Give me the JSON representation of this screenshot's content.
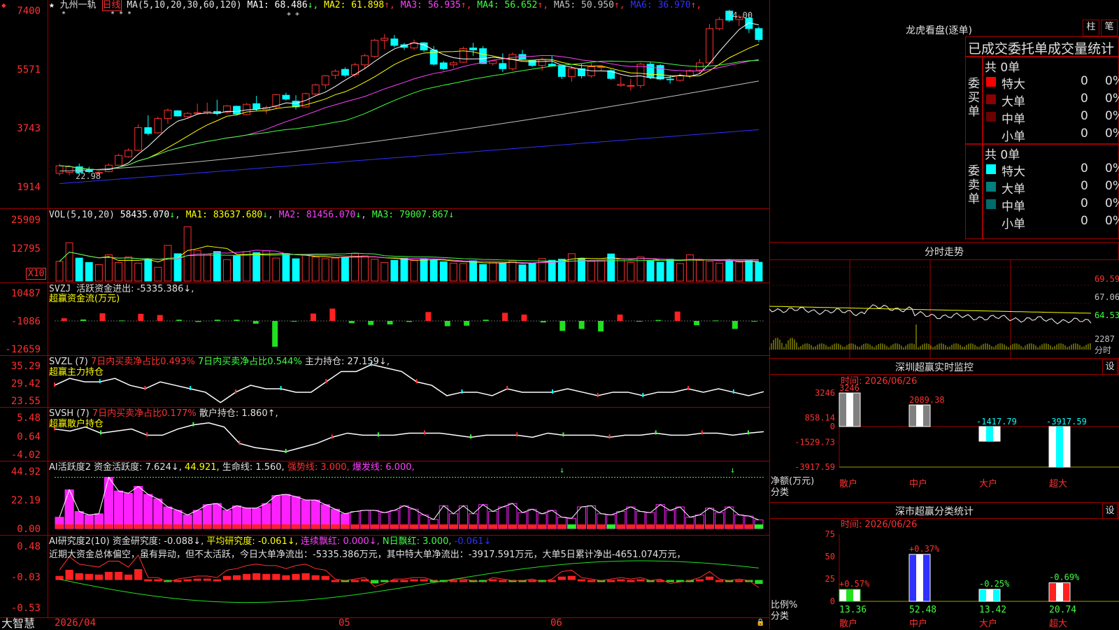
{
  "title": {
    "stock_name": "九州一轨",
    "period": "日线",
    "stars": "★",
    "ma_label": "MA(5,10,20,30,60,120)",
    "ma": [
      {
        "name": "MA1:",
        "value": "68.486",
        "arrow": "↓",
        "color": "#ffffff"
      },
      {
        "name": "MA2:",
        "value": "61.898",
        "arrow": "↑",
        "color": "#ffff00"
      },
      {
        "name": "MA3:",
        "value": "56.935",
        "arrow": "↑",
        "color": "#ff40ff"
      },
      {
        "name": "MA4:",
        "value": "56.652",
        "arrow": "↑",
        "color": "#40ff40"
      },
      {
        "name": "MA5:",
        "value": "50.950",
        "arrow": "↑",
        "color": "#c0c0c0"
      },
      {
        "name": "MA6:",
        "value": "36.970",
        "arrow": "↑",
        "color": "#3030ff"
      }
    ]
  },
  "vol_header": {
    "label": "VOL(5,10,20)",
    "value": "58435.070",
    "ma1": "MA1: 83637.680",
    "ma2": "MA2: 81456.070",
    "ma3": "MA3: 79007.867",
    "arrow": "↓",
    "unit": "X10"
  },
  "svzj_header": {
    "label": "SVZJ",
    "line": "活跃资金进出: -5335.386↓,",
    "sub": "超赢资金流(万元)"
  },
  "svzl_header": {
    "label": "SVZL (7)",
    "a": "7日内买卖净占比0.493%",
    "b": "7日内买卖净占比0.544%",
    "c": "主力持仓: 27.159↓,",
    "sub": "超赢主力持仓"
  },
  "svsh_header": {
    "label": "SVSH (7)",
    "a": "7日内买卖净占比0.177%",
    "c": "散户持仓: 1.860↑,",
    "sub": "超赢散户持仓"
  },
  "ai1_header": {
    "label": "AI活跃度2",
    "a": "资金活跃度: 7.624↓,",
    "b": "44.921,",
    "c": "生命线: 1.560,",
    "d": "强势线: 3.000,",
    "e": "爆发线: 6.000,"
  },
  "ai2_header": {
    "label": "AI研究度2(10)",
    "a": "资金研究度: -0.088↓,",
    "b": "平均研究度: -0.061↓,",
    "c": "连续飘红: 0.000↓,",
    "d": "N日飘红: 3.000,",
    "e": "-0.061↓"
  },
  "commentary": "近期大资金总体偏空，虽有异动，但不太活跃，今日大单净流出：-5335.386万元，其中特大单净流出：-3917.591万元，大单5日累计净出-4651.074万元，",
  "x_axis": {
    "app_name": "大智慧",
    "d0": "2026/04",
    "d1": "05",
    "d2": "06"
  },
  "right": {
    "dragon": {
      "title": "龙虎看盘(逐单)",
      "btn1": "柱",
      "btn2": "笔",
      "stat_title": "已成交委托单成交量统计",
      "buy_label": "委买单",
      "sell_label": "委卖单",
      "buy_total": "共 0单",
      "sell_total": "共 0单",
      "buy_rows": [
        {
          "name": "特大",
          "qty": "0",
          "pct": "0%",
          "color": "#ff0000"
        },
        {
          "name": "大单",
          "qty": "0",
          "pct": "0%",
          "color": "#8b0000"
        },
        {
          "name": "中单",
          "qty": "0",
          "pct": "0%",
          "color": "#6b0000"
        },
        {
          "name": "小单",
          "qty": "0",
          "pct": "0%",
          "color": ""
        }
      ],
      "sell_rows": [
        {
          "name": "特大",
          "qty": "0",
          "pct": "0%",
          "color": "#00ffff"
        },
        {
          "name": "大单",
          "qty": "0",
          "pct": "0%",
          "color": "#008080"
        },
        {
          "name": "中单",
          "qty": "0",
          "pct": "0%",
          "color": "#006b6b"
        },
        {
          "name": "小单",
          "qty": "0",
          "pct": "0%",
          "color": ""
        }
      ]
    },
    "minute": {
      "title": "分时走势",
      "p1": "69.59",
      "p2": "67.06",
      "p3": "64.53",
      "vol": "2287",
      "vol_unit": "分时"
    },
    "monitor": {
      "title": "深圳超赢实时监控",
      "btn": "设",
      "time": "时间: 2026/06/26",
      "ylabel": "净额(万元)",
      "xlabel": "分类"
    },
    "classify": {
      "title": "深市超赢分类统计",
      "btn": "设",
      "time": "时间: 2026/06/26",
      "ylabel": "比例%",
      "xlabel": "分类"
    }
  },
  "chart_data": [
    {
      "type": "candlestick",
      "title": "九州一轨 日线",
      "ylim": [
        19.14,
        74.0
      ],
      "y_ticks": [
        "7400",
        "5571",
        "3743",
        "1914"
      ],
      "annotations": [
        "74.00",
        "22.98"
      ],
      "ohlc": [
        [
          23.5,
          26.5,
          22.8,
          25.8
        ],
        [
          23.8,
          26,
          22.9,
          25.5
        ],
        [
          25.5,
          26.5,
          23.2,
          23.8
        ],
        [
          24.5,
          25.5,
          23.5,
          24
        ],
        [
          23.5,
          24.2,
          22.98,
          23.8
        ],
        [
          24,
          26.5,
          23.8,
          26
        ],
        [
          26,
          29.5,
          25.8,
          29
        ],
        [
          28.6,
          31.2,
          28.3,
          30.6
        ],
        [
          30.6,
          38.6,
          30.4,
          37.6
        ],
        [
          37.6,
          41.4,
          35.2,
          35.8
        ],
        [
          36,
          41,
          35.8,
          40.4
        ],
        [
          40.4,
          43.5,
          38.8,
          43
        ],
        [
          42.8,
          43,
          41,
          41.2
        ],
        [
          41,
          42.4,
          40.5,
          42
        ],
        [
          42.2,
          45,
          41.8,
          42.2
        ],
        [
          42.2,
          45.3,
          41.6,
          42.6
        ],
        [
          42.6,
          46.2,
          41.4,
          42
        ],
        [
          42.4,
          44.6,
          42,
          44.3
        ],
        [
          44.2,
          44.4,
          41.6,
          41.8
        ],
        [
          41.6,
          45.2,
          41.4,
          44.8
        ],
        [
          45,
          47.4,
          42.8,
          43.4
        ],
        [
          43.2,
          44.4,
          41.8,
          43.8
        ],
        [
          44,
          48,
          43.4,
          47.8
        ],
        [
          47.6,
          48.4,
          46,
          46.4
        ],
        [
          45.8,
          47.6,
          43.2,
          44
        ],
        [
          44,
          48.4,
          43.8,
          48.1
        ],
        [
          48,
          51.2,
          47.6,
          50.8
        ],
        [
          50.8,
          53.8,
          49.6,
          53.6
        ],
        [
          53.8,
          55.6,
          52.6,
          55
        ],
        [
          55.6,
          56.2,
          53.2,
          53.8
        ],
        [
          54,
          57.6,
          53.2,
          57
        ],
        [
          57,
          60.4,
          55.8,
          59.8
        ],
        [
          59.6,
          65,
          59.2,
          64.6
        ],
        [
          64.6,
          66.5,
          61.8,
          65.2
        ],
        [
          65,
          66.2,
          62.4,
          63
        ],
        [
          63.2,
          63.8,
          61.6,
          62.4
        ],
        [
          62.2,
          64.8,
          61.6,
          63.8
        ],
        [
          63.8,
          64,
          61,
          61.6
        ],
        [
          61.6,
          62.8,
          56.8,
          57.2
        ],
        [
          57.6,
          58.2,
          55.4,
          55.8
        ],
        [
          57,
          58.2,
          56,
          57.6
        ],
        [
          57.8,
          62.6,
          57.6,
          62
        ],
        [
          62.2,
          63.8,
          59.8,
          61.6
        ],
        [
          62,
          62.8,
          57.2,
          57.4
        ],
        [
          57.4,
          58.4,
          56.8,
          58.2
        ],
        [
          57.4,
          60.6,
          54.8,
          55.8
        ],
        [
          55.8,
          60.8,
          55.2,
          60.2
        ],
        [
          60.2,
          61.6,
          58.6,
          58.8
        ],
        [
          58.4,
          58.6,
          56.4,
          56.8
        ],
        [
          56.8,
          59.2,
          55.2,
          58.6
        ],
        [
          57.2,
          59.8,
          56.4,
          56.6
        ],
        [
          56.6,
          57.2,
          52.6,
          53.4
        ],
        [
          53.4,
          56.8,
          51.8,
          55.8
        ],
        [
          55.8,
          57.4,
          52.8,
          53.6
        ],
        [
          53.6,
          57.6,
          53,
          56.4
        ],
        [
          56.4,
          56.6,
          55.2,
          56.4
        ],
        [
          55.2,
          55.6,
          52.4,
          52.8
        ],
        [
          50.6,
          53.4,
          50.2,
          51
        ],
        [
          50.4,
          52.6,
          49,
          50.6
        ],
        [
          50.6,
          57.6,
          49.8,
          57.2
        ],
        [
          57.2,
          58,
          52.6,
          53.2
        ],
        [
          56.8,
          57.2,
          52.2,
          52.6
        ],
        [
          52.6,
          53.8,
          51.2,
          52.4
        ],
        [
          52.2,
          54.4,
          51.8,
          53.6
        ],
        [
          53.6,
          55.6,
          52.8,
          55.2
        ],
        [
          55.4,
          58.8,
          54.2,
          57.6
        ],
        [
          57.6,
          69.6,
          57.2,
          68.2
        ],
        [
          68.2,
          71.8,
          67.6,
          71
        ],
        [
          73.6,
          74,
          70.2,
          70.8
        ],
        [
          71,
          72.4,
          69,
          71.8
        ],
        [
          71.4,
          72.8,
          66.8,
          68.2
        ],
        [
          68.2,
          68.8,
          64,
          64.8
        ]
      ],
      "ma_series": [
        {
          "name": "MA1",
          "start": [
            0,
            24.2
          ],
          "end": [
            71,
            68.486
          ]
        },
        {
          "name": "MA6",
          "start": [
            0,
            20.3
          ],
          "end": [
            71,
            36.97
          ]
        }
      ]
    },
    {
      "type": "bar",
      "title": "VOL(5,10,20)",
      "y_ticks": [
        "25909",
        "12795"
      ],
      "ylim": [
        0,
        30000
      ],
      "values": [
        9000,
        17500,
        10500,
        8500,
        7500,
        12000,
        8500,
        11000,
        8200,
        9800,
        6300,
        16300,
        12500,
        24800,
        14000,
        12300,
        13500,
        9800,
        11500,
        13500,
        13000,
        13800,
        10500,
        12500,
        10200,
        12000,
        11000,
        10200,
        10500,
        10800,
        12500,
        11500,
        10000,
        8500,
        9500,
        10500,
        9400,
        10000,
        9400,
        8800,
        8200,
        8000,
        9300,
        7600,
        8400,
        8100,
        9300,
        7400,
        8000,
        10300,
        9500,
        10000,
        12500,
        10200,
        9000,
        9500,
        12400,
        10000,
        8500,
        11000,
        9500,
        8600,
        10000,
        8000,
        12000,
        9500,
        9000,
        8200,
        9200,
        8700,
        9400,
        8600
      ],
      "colors_by_close": "red up / cyan down"
    },
    {
      "type": "bar",
      "title": "SVZJ 活跃资金进出",
      "y_ticks": [
        "10487",
        "-1086",
        "-12659"
      ],
      "ylim": [
        -12659,
        10487
      ],
      "values": [
        0,
        -500,
        2000,
        -900,
        1800,
        1300,
        -600,
        -1500,
        -600,
        -600,
        -2200,
        -11500,
        -1200,
        1900,
        3900,
        -2000,
        -2700,
        -2500,
        -1500,
        2500,
        -3200,
        -3000,
        -600,
        2200,
        1500,
        -1700,
        -5100,
        -4300,
        -5335,
        1500,
        -1100,
        -700,
        2700,
        -2800,
        -900,
        -4300,
        -1200
      ]
    },
    {
      "type": "line",
      "title": "SVZL 主力持仓",
      "y_ticks": [
        "35.29",
        "29.42",
        "23.55"
      ],
      "ylim": [
        23.55,
        35.29
      ],
      "values": [
        29,
        31,
        30,
        30,
        31,
        29,
        28,
        30,
        29,
        28,
        27,
        24,
        27,
        29,
        28,
        28,
        27,
        27,
        30,
        33,
        33,
        35,
        34,
        33,
        30,
        29,
        26,
        27,
        27,
        26,
        28,
        27,
        27,
        27,
        28,
        27,
        26,
        27,
        27,
        26,
        27,
        27,
        28,
        27,
        28,
        27,
        26,
        27.159
      ]
    },
    {
      "type": "line",
      "title": "SVSH 散户持仓",
      "y_ticks": [
        "5.48",
        "0.64",
        "-4.02"
      ],
      "ylim": [
        -4.02,
        5.48
      ],
      "values": [
        2.5,
        2,
        3,
        1.5,
        2,
        2.5,
        1,
        1,
        2.5,
        3.5,
        4,
        3,
        -1,
        -2,
        -2.5,
        -3,
        -2,
        -1,
        0.5,
        1.5,
        1,
        1,
        1,
        1.5,
        1.5,
        1.5,
        1,
        0.5,
        1,
        1,
        1,
        0.5,
        1.5,
        1,
        1,
        1,
        0.5,
        1,
        1,
        1.5,
        1,
        1,
        1.5,
        1.5,
        1,
        1.5,
        1.86
      ]
    },
    {
      "type": "bar",
      "title": "AI活跃度2",
      "y_ticks": [
        "44.92",
        "22.19",
        "0.00"
      ],
      "ylim": [
        0,
        49
      ],
      "values": [
        10,
        34,
        15,
        12,
        13,
        45,
        33,
        31,
        37,
        30,
        26,
        19,
        16,
        12,
        16,
        21,
        22,
        16,
        20,
        18,
        18,
        22,
        29,
        30,
        28,
        25,
        25,
        21,
        17,
        13,
        15,
        16,
        16,
        14,
        16,
        20,
        17,
        12,
        8,
        20,
        13,
        20,
        13,
        21,
        15,
        19,
        22,
        14,
        17,
        13,
        16,
        10,
        9,
        19,
        20,
        13,
        12,
        15,
        19,
        15,
        14,
        21,
        16,
        19,
        10,
        12,
        18,
        14,
        19,
        12,
        11,
        7.624
      ],
      "guide_line": 44.92
    },
    {
      "type": "bar",
      "title": "AI研究度2(10)",
      "y_ticks": [
        "0.48",
        "-0.03",
        "-0.53"
      ],
      "ylim": [
        -0.53,
        0.48
      ],
      "values": [
        0.03,
        0.12,
        0.07,
        0.06,
        0.05,
        0.09,
        0.09,
        0.05,
        0.13,
        -0.02,
        -0.02,
        -0.05,
        -0.03,
        -0.02,
        -0.01,
        -0.01,
        -0.02,
        0.03,
        0.04,
        0.06,
        0.07,
        0.06,
        0.06,
        0.04,
        0.06,
        0.07,
        0.04,
        0.03,
        -0.03,
        -0.04,
        -0.03,
        -0.02,
        -0.08,
        -0.06,
        -0.03,
        -0.03,
        -0.02,
        -0.02,
        -0.04,
        -0.05,
        -0.03,
        -0.03,
        -0.04,
        -0.05,
        -0.02,
        -0.03,
        -0.04,
        -0.04,
        -0.03,
        -0.05,
        -0.03,
        0.02,
        0.03,
        -0.02,
        -0.03,
        -0.04,
        -0.03,
        -0.02,
        -0.03,
        -0.02,
        -0.04,
        -0.03,
        -0.06,
        -0.05,
        -0.04,
        -0.02,
        0.02,
        -0.03,
        -0.04,
        -0.03,
        -0.04,
        -0.088
      ]
    },
    {
      "type": "bar",
      "title": "深圳超赢实时监控",
      "categories": [
        "散户",
        "中户",
        "大户",
        "超大"
      ],
      "values": [
        3246,
        2089.38,
        -1417.79,
        -3917.59
      ],
      "y_ticks": [
        "3246",
        "858.14",
        "0",
        "-1529.73",
        "-3917.59"
      ],
      "ylim": [
        -3917.59,
        3246
      ]
    },
    {
      "type": "bar",
      "title": "深市超赢分类统计",
      "categories": [
        "散户",
        "中户",
        "大户",
        "超大"
      ],
      "values": [
        13.36,
        52.48,
        13.42,
        20.74
      ],
      "changes": [
        "+0.57%",
        "+0.37%",
        "-0.25%",
        "-0.69%"
      ],
      "y_ticks": [
        "75",
        "50",
        "25",
        "0"
      ],
      "ylim": [
        0,
        75
      ]
    }
  ]
}
